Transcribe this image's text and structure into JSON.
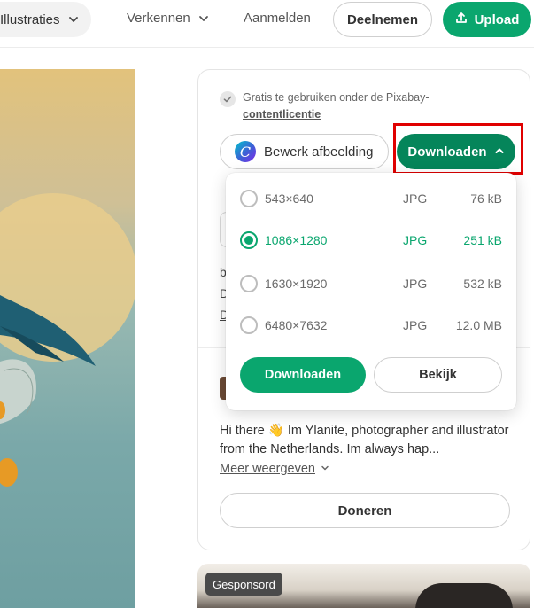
{
  "nav": {
    "illustrations_label": "Illustraties",
    "explore_label": "Verkennen",
    "login_label": "Aanmelden",
    "join_label": "Deelnemen",
    "upload_label": "Upload"
  },
  "license": {
    "text": "Gratis te gebruiken onder de Pixabay-",
    "link": "contentlicentie"
  },
  "actions": {
    "edit_label": "Bewerk afbeelding",
    "canva_glyph": "C",
    "download_label": "Downloaden"
  },
  "download_options": [
    {
      "resolution": "543×640",
      "format": "JPG",
      "size": "76 kB",
      "selected": false
    },
    {
      "resolution": "1086×1280",
      "format": "JPG",
      "size": "251 kB",
      "selected": true
    },
    {
      "resolution": "1630×1920",
      "format": "JPG",
      "size": "532 kB",
      "selected": false
    },
    {
      "resolution": "6480×7632",
      "format": "JPG",
      "size": "12.0 MB",
      "selected": false
    }
  ],
  "dropdown": {
    "download_label": "Downloaden",
    "view_label": "Bekijk"
  },
  "author": {
    "partial_line1": "b",
    "partial_line2": "D",
    "partial_line3": "D",
    "bio": "Hi there 👋 Im Ylanite, photographer and illustrator from the Netherlands. Im always hap...",
    "more_label": "Meer weergeven",
    "donate_label": "Doneren"
  },
  "sponsored": {
    "badge": "Gesponsord"
  },
  "colors": {
    "accent": "#0aa66e",
    "accent_dark": "#05855a",
    "highlight": "#e00000"
  }
}
